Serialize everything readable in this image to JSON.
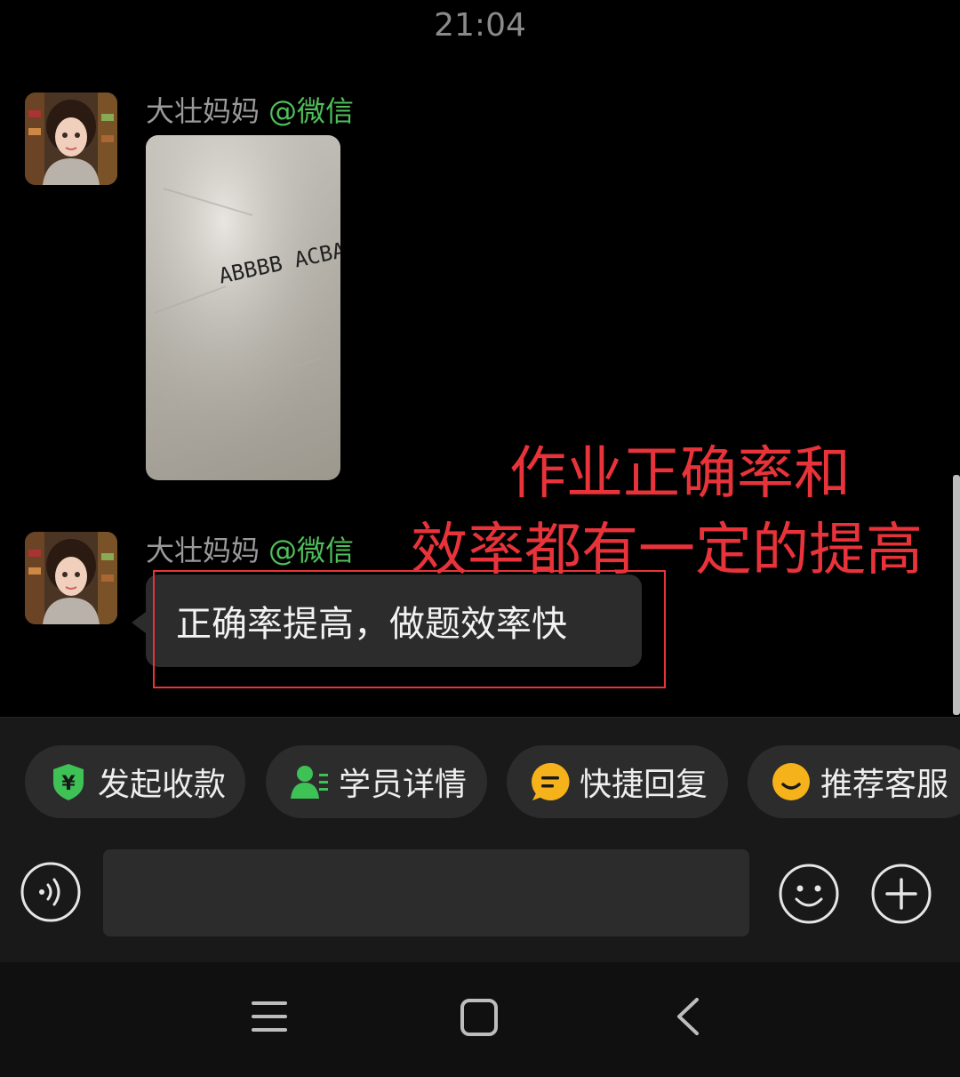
{
  "status_bar": {
    "time": "21:04"
  },
  "messages": [
    {
      "sender": "大壮妈妈",
      "tag": "@微信",
      "type": "image",
      "image_text": "ABBBB ACBAA AABAA"
    },
    {
      "sender": "大壮妈妈",
      "tag": "@微信",
      "type": "text",
      "text": "正确率提高，做题效率快"
    }
  ],
  "overlay_caption": {
    "line1": "作业正确率和",
    "line2": "效率都有一定的提高"
  },
  "quick_actions": [
    {
      "label": "发起收款",
      "icon": "yuan-shield-icon",
      "color": "#3ec155"
    },
    {
      "label": "学员详情",
      "icon": "user-detail-icon",
      "color": "#3ec155"
    },
    {
      "label": "快捷回复",
      "icon": "quick-reply-icon",
      "color": "#f6b21b"
    },
    {
      "label": "推荐客服",
      "icon": "service-face-icon",
      "color": "#f6b21b"
    }
  ],
  "input": {
    "placeholder": ""
  },
  "colors": {
    "accent_green": "#4fbf59",
    "annotation_red": "#e8333a"
  }
}
